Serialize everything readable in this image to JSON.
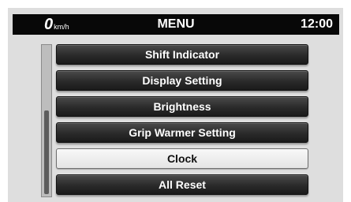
{
  "header": {
    "speed_value": "0",
    "speed_unit": "km/h",
    "title": "MENU",
    "time": "12:00"
  },
  "menu": {
    "items": [
      {
        "label": "Shift Indicator",
        "selected": false
      },
      {
        "label": "Display Setting",
        "selected": false
      },
      {
        "label": "Brightness",
        "selected": false
      },
      {
        "label": "Grip Warmer Setting",
        "selected": false
      },
      {
        "label": "Clock",
        "selected": true
      },
      {
        "label": "All Reset",
        "selected": false
      }
    ]
  },
  "scrollbar": {
    "position_fraction": 1.0
  },
  "colors": {
    "header_bg": "#080808",
    "panel_bg": "#dedede",
    "item_dark": "#2a2a2a",
    "item_selected": "#f0f0f0"
  }
}
